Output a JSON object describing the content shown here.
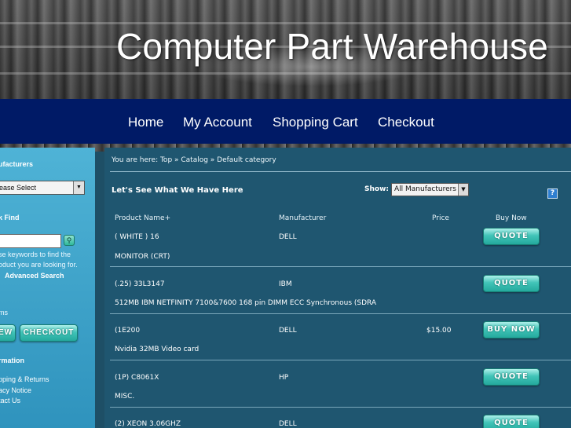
{
  "site": {
    "title": "Computer Part Warehouse"
  },
  "nav": {
    "items": [
      {
        "label": "Home"
      },
      {
        "label": "My Account"
      },
      {
        "label": "Shopping Cart"
      },
      {
        "label": "Checkout"
      }
    ]
  },
  "sidebar": {
    "manufacturers_heading": "ufacturers",
    "manufacturers_select_value": "ease Select",
    "quick_find_heading": "k Find",
    "quick_find_help_line1": "se keywords to find the",
    "quick_find_help_line2": "oduct you are looking for.",
    "advanced_search_label": "Advanced Search",
    "cart_heading": "ms",
    "view_button_label": "EW",
    "checkout_button_label": "CHECKOUT",
    "information_heading": "rmation",
    "info_links": [
      {
        "label": "pping & Returns"
      },
      {
        "label": "acy Notice"
      },
      {
        "label": "tact Us"
      }
    ]
  },
  "main": {
    "breadcrumb": "You are here: Top » Catalog » Default category",
    "section_title": "Let's See What We Have Here",
    "show_label": "Show:",
    "show_select_value": "All Manufacturers",
    "help_icon_glyph": "?",
    "columns": {
      "product": "Product Name+",
      "manufacturer": "Manufacturer",
      "price": "Price",
      "buy": "Buy Now"
    },
    "products": [
      {
        "name": "( WHITE ) 16",
        "description": "MONITOR (CRT)",
        "manufacturer": "DELL",
        "price": "",
        "button": "QUOTE"
      },
      {
        "name": "(.25) 33L3147",
        "description": "512MB IBM NETFINITY 7100&7600 168 pin DIMM ECC Synchronous (SDRA",
        "manufacturer": "IBM",
        "price": "",
        "button": "QUOTE"
      },
      {
        "name": "(1E200",
        "description": "Nvidia 32MB Video card",
        "manufacturer": "DELL",
        "price": "$15.00",
        "button": "BUY NOW"
      },
      {
        "name": "(1P) C8061X",
        "description": "MISC.",
        "manufacturer": "HP",
        "price": "",
        "button": "QUOTE"
      },
      {
        "name": "(2) XEON 3.06GHZ",
        "description": "",
        "manufacturer": "DELL",
        "price": "",
        "button": "QUOTE"
      }
    ]
  }
}
